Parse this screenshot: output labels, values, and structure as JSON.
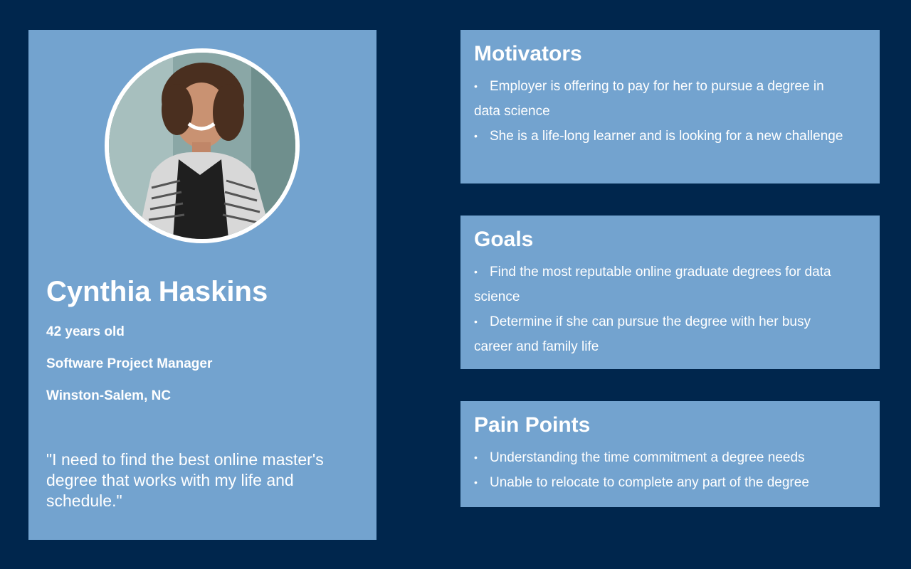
{
  "profile": {
    "name": "Cynthia Haskins",
    "age": "42 years old",
    "job_title": "Software Project Manager",
    "location": "Winston-Salem, NC",
    "quote": "\"I need to find the best online master's degree that works with my life and schedule.\""
  },
  "motivators": {
    "title": "Motivators",
    "items": [
      "Employer is offering to pay for her to pursue a degree in data science",
      "She is a life-long learner and is looking for a new challenge"
    ]
  },
  "goals": {
    "title": "Goals",
    "items": [
      "Find the most reputable online graduate degrees for data science",
      "Determine if she can pursue the degree with her busy career and family life"
    ]
  },
  "pain_points": {
    "title": "Pain Points",
    "items": [
      "Understanding the time commitment a degree needs",
      "Unable to relocate to complete any part of the degree"
    ]
  },
  "colors": {
    "background": "#00264d",
    "card": "#73a3cf",
    "text": "#ffffff"
  }
}
